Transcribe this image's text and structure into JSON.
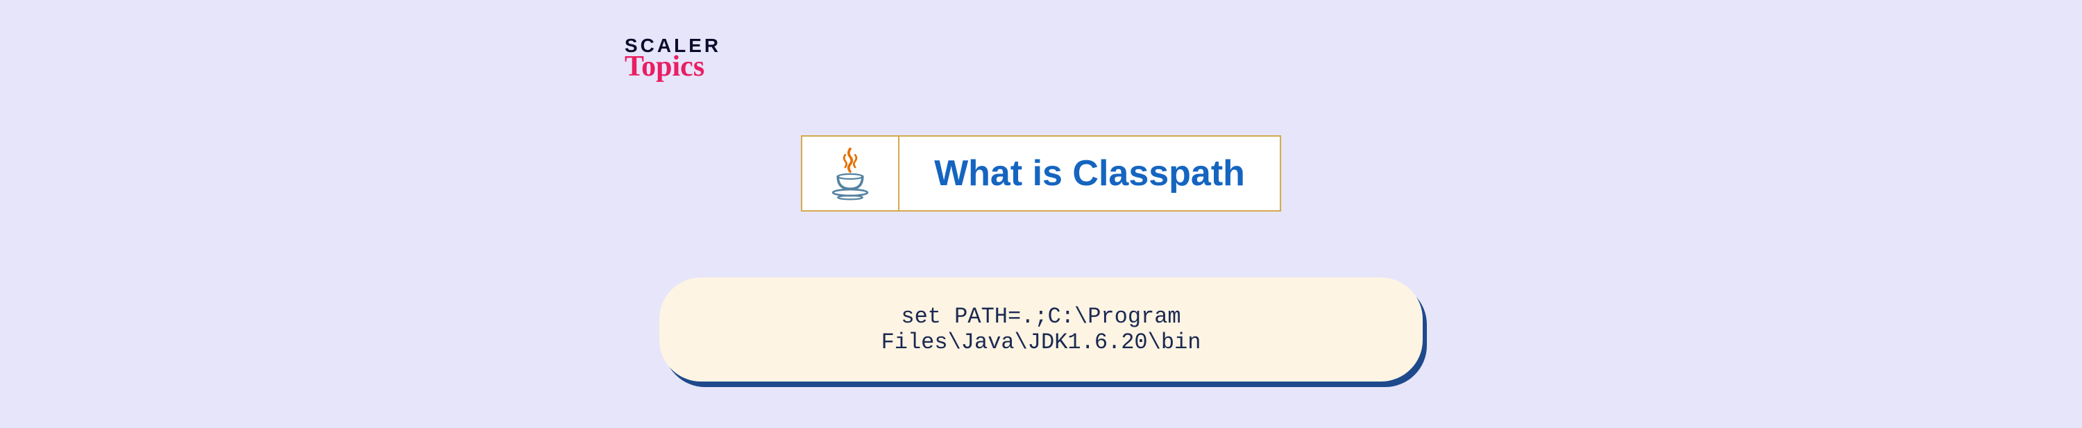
{
  "logo": {
    "line1": "SCALER",
    "line2": "Topics"
  },
  "title": "What is Classpath",
  "icon_name": "java-logo",
  "code": "set PATH=.;C:\\Program Files\\Java\\JDK1.6.20\\bin"
}
